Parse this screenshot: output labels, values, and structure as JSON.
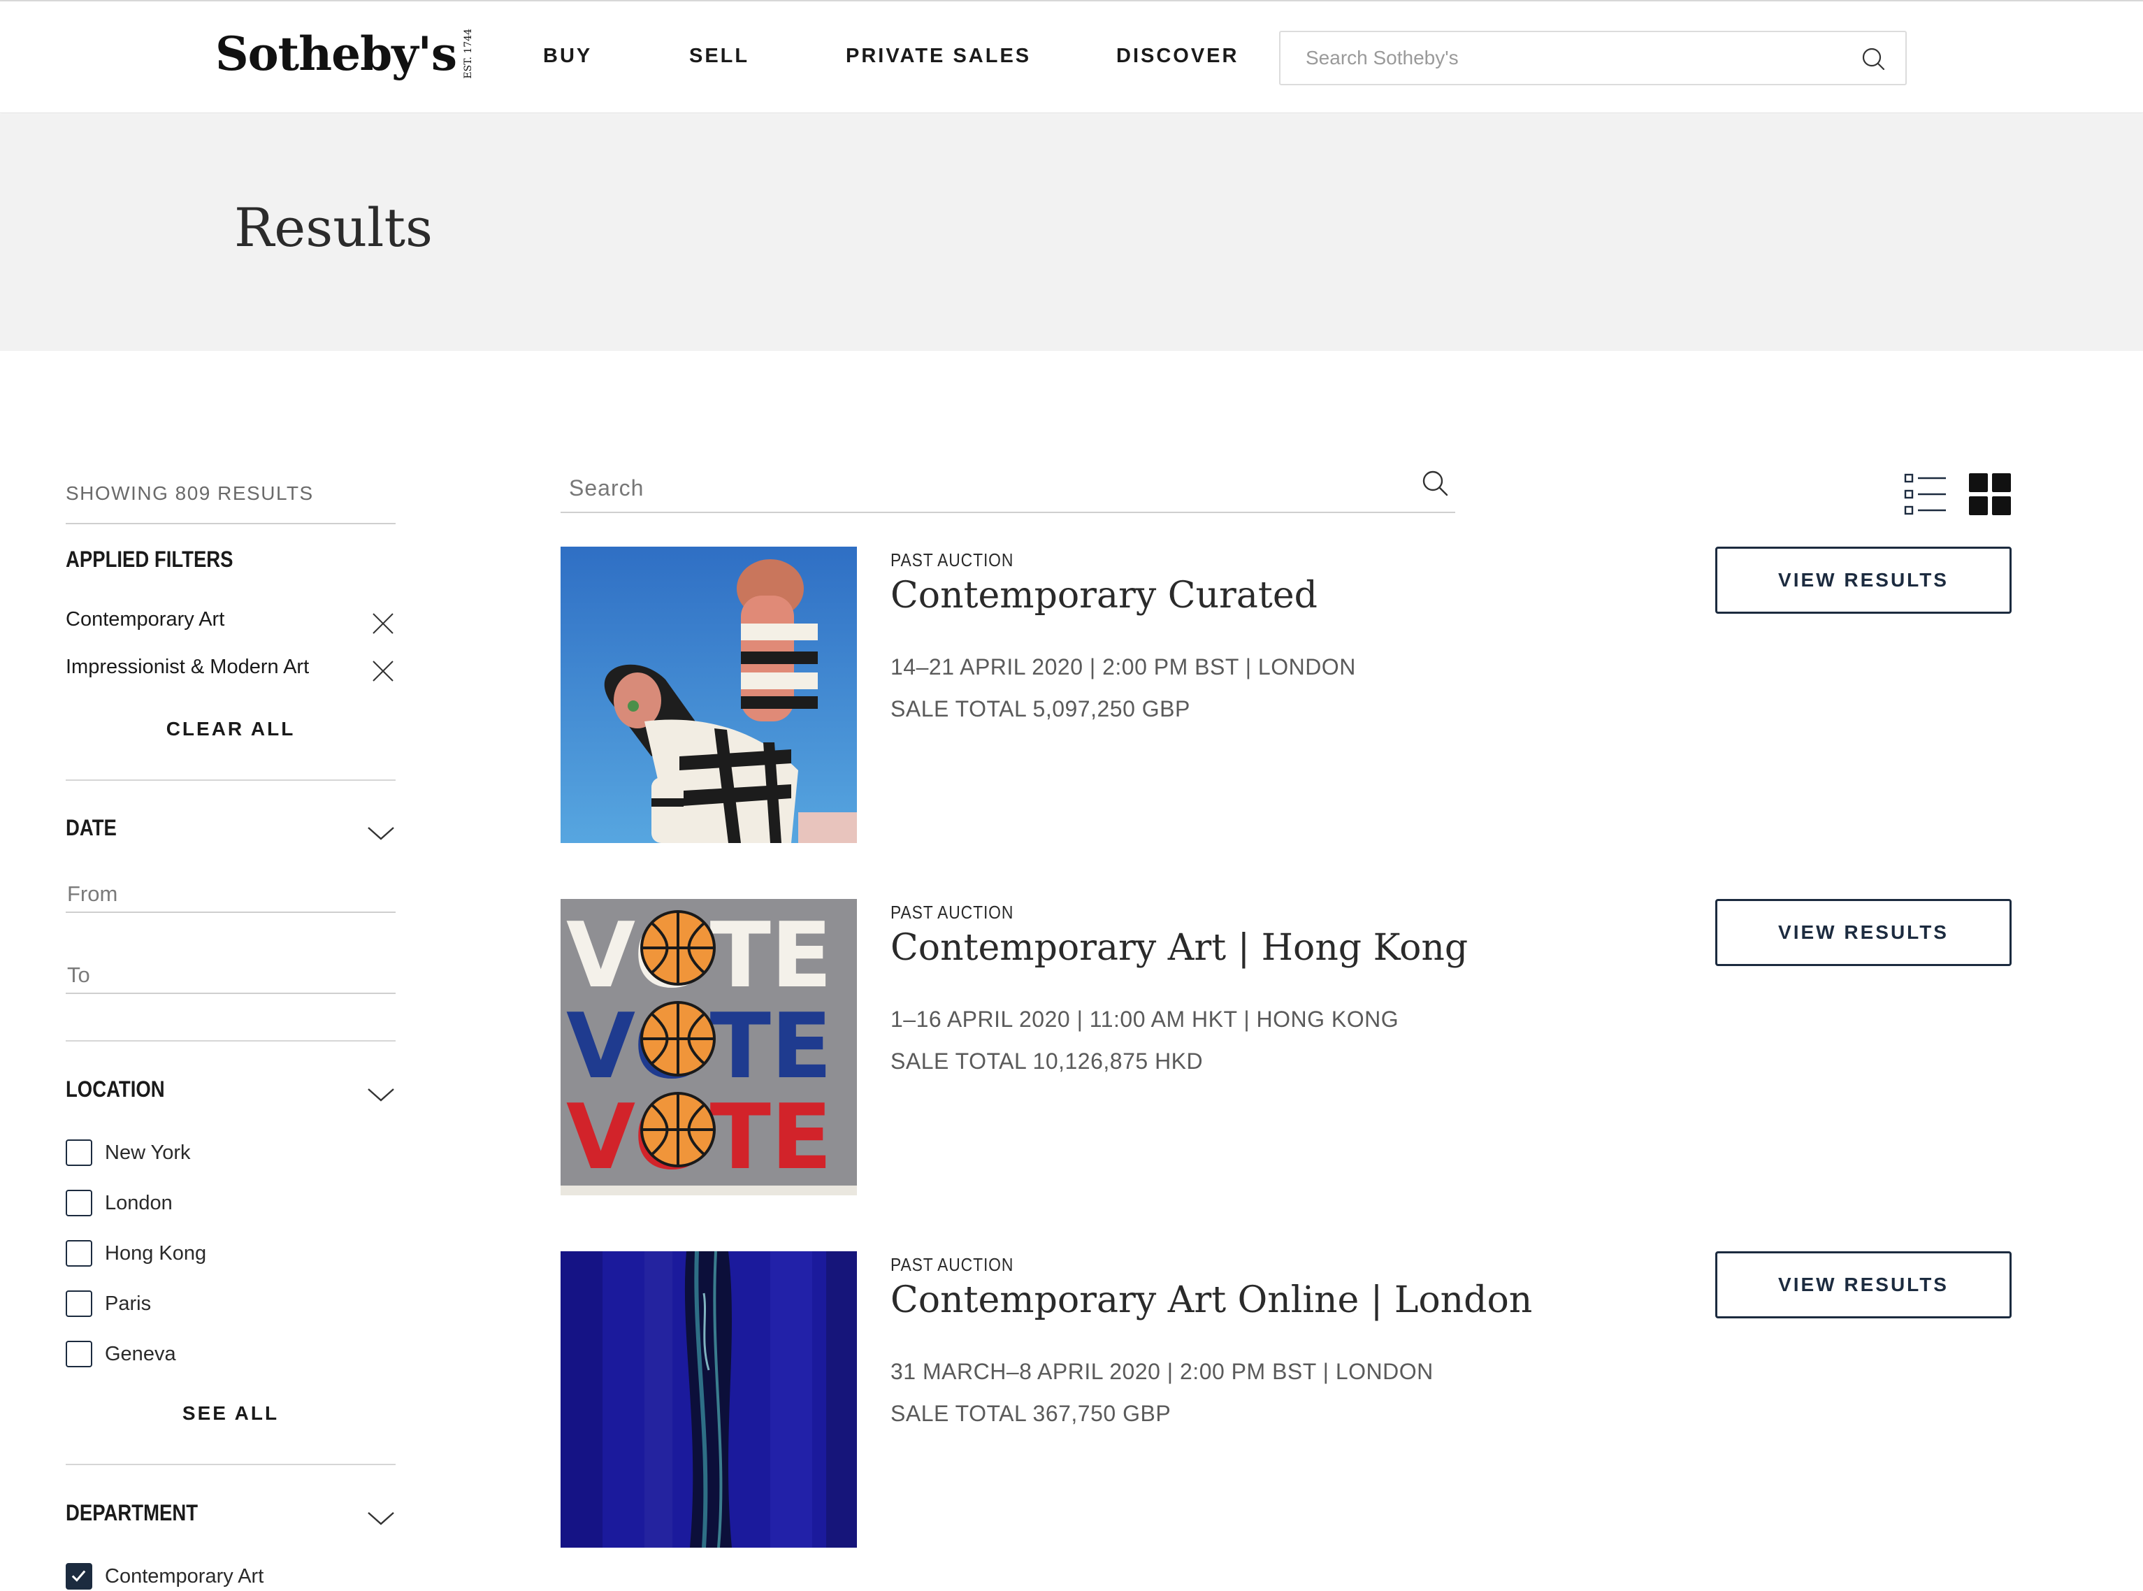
{
  "header": {
    "logo": "Sotheby's",
    "logo_est": "EST. 1744",
    "nav": [
      {
        "label": "BUY"
      },
      {
        "label": "SELL"
      },
      {
        "label": "PRIVATE SALES"
      },
      {
        "label": "DISCOVER"
      }
    ],
    "search_placeholder": "Search Sotheby's"
  },
  "banner": {
    "title": "Results"
  },
  "sidebar": {
    "showing": "SHOWING 809 RESULTS",
    "applied_filters_title": "APPLIED FILTERS",
    "applied_filters": [
      {
        "label": "Contemporary Art"
      },
      {
        "label": "Impressionist & Modern Art"
      }
    ],
    "clear_all": "CLEAR ALL",
    "date": {
      "title": "DATE",
      "from_placeholder": "From",
      "to_placeholder": "To"
    },
    "location": {
      "title": "LOCATION",
      "options": [
        {
          "label": "New York",
          "checked": false
        },
        {
          "label": "London",
          "checked": false
        },
        {
          "label": "Hong Kong",
          "checked": false
        },
        {
          "label": "Paris",
          "checked": false
        },
        {
          "label": "Geneva",
          "checked": false
        }
      ],
      "see_all": "SEE ALL"
    },
    "department": {
      "title": "DEPARTMENT",
      "options": [
        {
          "label": "Contemporary Art",
          "checked": true
        }
      ]
    }
  },
  "main": {
    "search_placeholder": "Search",
    "results": [
      {
        "kicker": "PAST AUCTION",
        "title": "Contemporary Curated",
        "dates": "14–21 APRIL 2020 | 2:00 PM BST | LONDON",
        "total": "SALE TOTAL 5,097,250 GBP",
        "button": "VIEW RESULTS"
      },
      {
        "kicker": "PAST AUCTION",
        "title": "Contemporary Art | Hong Kong",
        "dates": "1–16 APRIL 2020 | 11:00 AM HKT | HONG KONG",
        "total": "SALE TOTAL 10,126,875 HKD",
        "button": "VIEW RESULTS"
      },
      {
        "kicker": "PAST AUCTION",
        "title": "Contemporary Art Online | London",
        "dates": "31 MARCH–8 APRIL 2020 | 2:00 PM BST | LONDON",
        "total": "SALE TOTAL 367,750 GBP",
        "button": "VIEW RESULTS"
      }
    ],
    "thumb2_word": "VOTE"
  },
  "colors": {
    "navy": "#1c2b3f",
    "banner_bg": "#f2f2f2"
  }
}
